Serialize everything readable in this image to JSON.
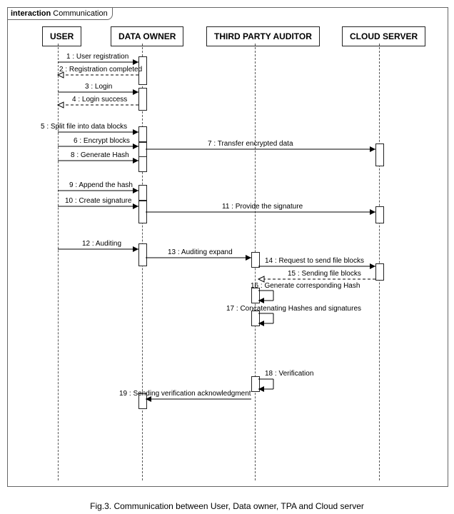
{
  "frame": {
    "kind": "interaction",
    "title": " Communication"
  },
  "caption": "Fig.3. Communication between User, Data owner, TPA and Cloud server",
  "lanes": [
    {
      "id": "user",
      "name": "USER"
    },
    {
      "id": "owner",
      "name": "DATA OWNER"
    },
    {
      "id": "tpa",
      "name": "THIRD PARTY AUDITOR"
    },
    {
      "id": "cloud",
      "name": "CLOUD SERVER"
    }
  ],
  "messages": [
    {
      "n": 1,
      "from": "user",
      "to": "owner",
      "kind": "call",
      "label": "1 : User registration"
    },
    {
      "n": 2,
      "from": "owner",
      "to": "user",
      "kind": "return",
      "label": "2 : Registration completed"
    },
    {
      "n": 3,
      "from": "user",
      "to": "owner",
      "kind": "call",
      "label": "3 : Login"
    },
    {
      "n": 4,
      "from": "owner",
      "to": "user",
      "kind": "return",
      "label": "4 : Login success"
    },
    {
      "n": 5,
      "from": "user",
      "to": "owner",
      "kind": "call",
      "label": "5 : Split file into data blocks"
    },
    {
      "n": 6,
      "from": "user",
      "to": "owner",
      "kind": "call",
      "label": "6 : Encrypt blocks"
    },
    {
      "n": 7,
      "from": "owner",
      "to": "cloud",
      "kind": "call",
      "label": "7 : Transfer encrypted data"
    },
    {
      "n": 8,
      "from": "user",
      "to": "owner",
      "kind": "call",
      "label": "8 : Generate Hash"
    },
    {
      "n": 9,
      "from": "user",
      "to": "owner",
      "kind": "call",
      "label": "9 : Append the hash"
    },
    {
      "n": 10,
      "from": "user",
      "to": "owner",
      "kind": "call",
      "label": "10 : Create signature"
    },
    {
      "n": 11,
      "from": "owner",
      "to": "cloud",
      "kind": "call",
      "label": "11 : Provide the signature"
    },
    {
      "n": 12,
      "from": "user",
      "to": "owner",
      "kind": "call",
      "label": "12 : Auditing"
    },
    {
      "n": 13,
      "from": "owner",
      "to": "tpa",
      "kind": "call",
      "label": "13 : Auditing expand"
    },
    {
      "n": 14,
      "from": "tpa",
      "to": "cloud",
      "kind": "call",
      "label": "14 : Request to send file blocks"
    },
    {
      "n": 15,
      "from": "cloud",
      "to": "tpa",
      "kind": "return",
      "label": "15 : Sending file blocks"
    },
    {
      "n": 16,
      "from": "tpa",
      "to": "tpa",
      "kind": "self",
      "label": "16 : Generate corresponding Hash"
    },
    {
      "n": 17,
      "from": "tpa",
      "to": "tpa",
      "kind": "self",
      "label": "17 : Concatenating Hashes and signatures"
    },
    {
      "n": 18,
      "from": "tpa",
      "to": "tpa",
      "kind": "self",
      "label": "18 : Verification"
    },
    {
      "n": 19,
      "from": "tpa",
      "to": "owner",
      "kind": "call",
      "label": "19 : Sending verification acknowledgment"
    }
  ]
}
